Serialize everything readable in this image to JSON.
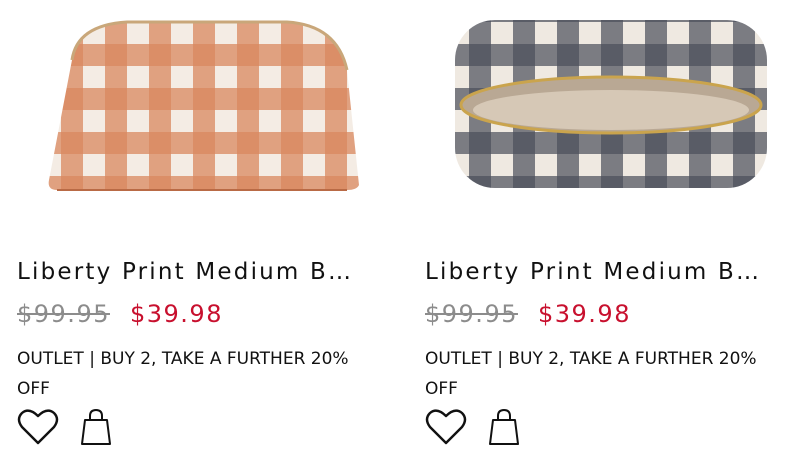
{
  "products": [
    {
      "title": "Liberty Print Medium B…",
      "was_price": "$99.95",
      "sale_price": "$39.98",
      "promo": "OUTLET | BUY 2, TAKE A FURTHER 20% OFF",
      "image_pattern": "rust gingham",
      "colors": {
        "primary": "#c46a3e",
        "secondary": "#f5ede6"
      }
    },
    {
      "title": "Liberty Print Medium B…",
      "was_price": "$99.95",
      "sale_price": "$39.98",
      "promo": "OUTLET | BUY 2, TAKE A FURTHER 20% OFF",
      "image_pattern": "navy gingham open",
      "colors": {
        "primary": "#2e3440",
        "secondary": "#efe9e1"
      }
    }
  ],
  "icons": {
    "wishlist": "heart-icon",
    "cart": "shopping-bag-icon"
  },
  "theme": {
    "sale_color": "#c8102e",
    "muted_color": "#8c8c8c"
  }
}
